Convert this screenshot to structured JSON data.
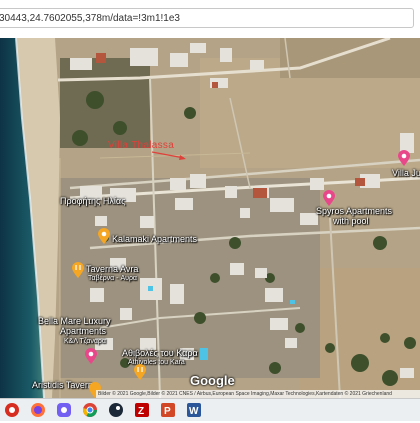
{
  "browser": {
    "url": "30443,24.7602055,378m/data=!3m1!1e3"
  },
  "map": {
    "type": "satellite",
    "labels": {
      "villa_thalassa": "Villa Thalassa",
      "villa_ju": "Villa Ju",
      "profitis_ilias": "Προφήτης Ηλίας",
      "spyros_apartments_line1": "Spyros Apartments",
      "spyros_apartments_line2": "with pool",
      "kalamaki_apartments": "Kalamaki Apartments",
      "taverna_avra": "Taverna Avra",
      "taverna_avra_sub": "Ταβέρνα - Aυρα",
      "bella_mare_line1": "Bella Mare Luxury",
      "bella_mare_line2": "Apartments",
      "thivoles_line1": "Αθιβολές του Καρα",
      "thivoles_sub": "Athivoles tou Kara",
      "kara_small": "Κ&Λ  Τζαναρα",
      "aristidis_taverna": "Aristidis Tavern",
      "google": "Google"
    },
    "attribution": "Bilder © 2021 Google,Bilder © 2021 CNES / Airbus,European Space Imaging,Maxar Technologies,Kartendaten © 2021   Griechenland",
    "marker_colors": {
      "hotel": "#e8488a",
      "food": "#f5a623",
      "target": "#d93b35"
    }
  },
  "taskbar": {
    "icons": [
      "start-icon",
      "firefox-icon",
      "viber-icon",
      "chrome-icon",
      "steam-icon",
      "filezilla-icon",
      "powerpoint-icon",
      "word-icon"
    ],
    "colors": [
      "#d62d20",
      "#ff7139",
      "#7360f2",
      "#4285f4",
      "#1b2838",
      "#bf0000",
      "#d24726",
      "#2b579a"
    ]
  }
}
